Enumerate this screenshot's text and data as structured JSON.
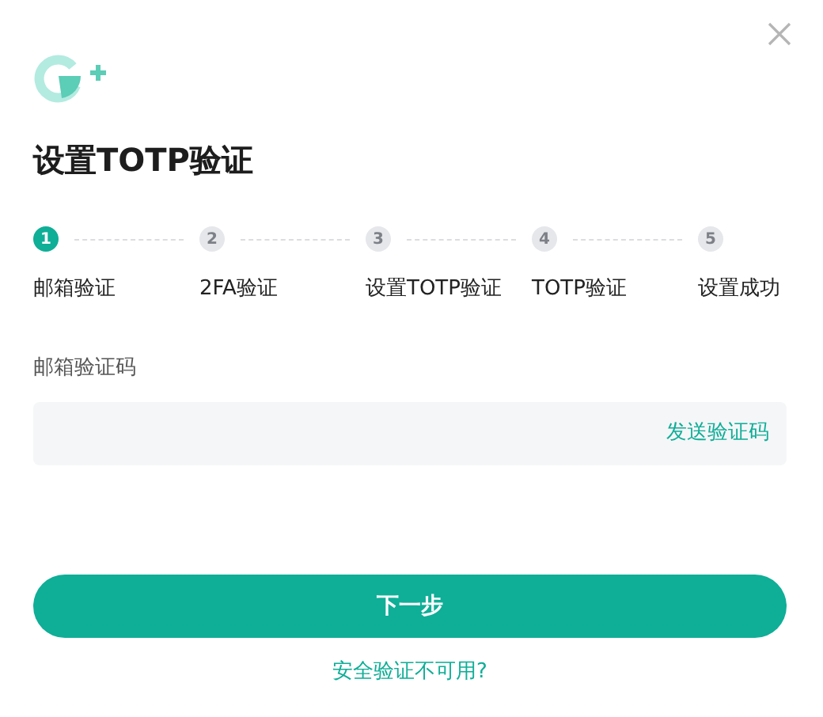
{
  "title": "设置TOTP验证",
  "steps": [
    {
      "number": "1",
      "label": "邮箱验证",
      "active": true
    },
    {
      "number": "2",
      "label": "2FA验证",
      "active": false
    },
    {
      "number": "3",
      "label": "设置TOTP验证",
      "active": false
    },
    {
      "number": "4",
      "label": "TOTP验证",
      "active": false
    },
    {
      "number": "5",
      "label": "设置成功",
      "active": false
    }
  ],
  "field": {
    "label": "邮箱验证码",
    "action": "发送验证码"
  },
  "next_button": "下一步",
  "help_link": "安全验证不可用?"
}
